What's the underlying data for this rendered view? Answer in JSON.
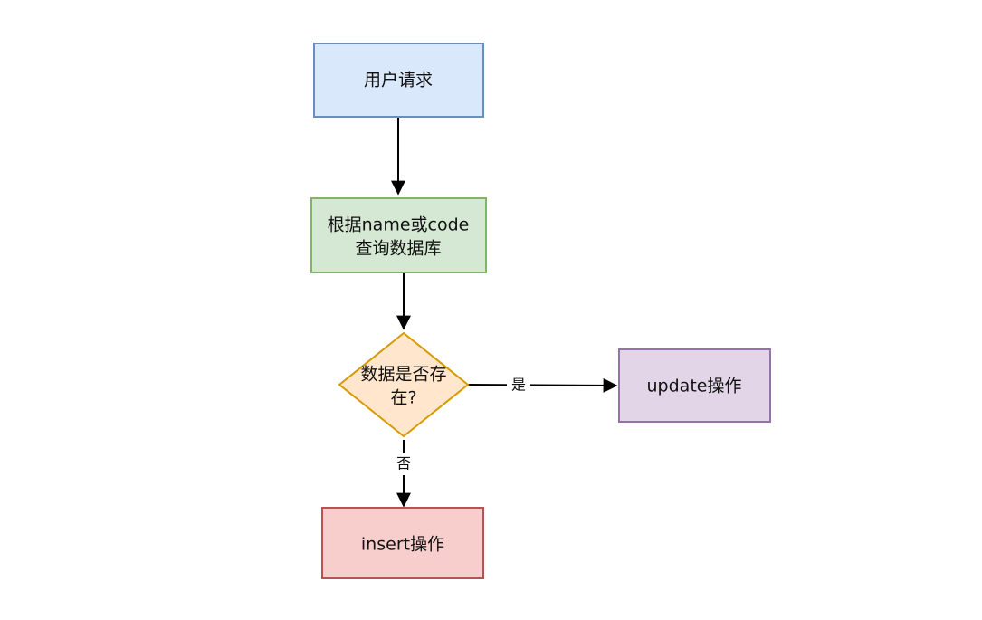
{
  "diagram": {
    "nodes": {
      "user_request": {
        "text": "用户请求",
        "fill": "#dae8fc",
        "stroke": "#6c8ebf"
      },
      "query_db": {
        "line1": "根据name或code",
        "line2": "查询数据库",
        "fill": "#d5e8d4",
        "stroke": "#82b366"
      },
      "exists_check": {
        "line1": "数据是否存",
        "line2": "在?",
        "fill": "#ffe6cc",
        "stroke": "#d79b00"
      },
      "update_op": {
        "text": "update操作",
        "fill": "#e1d5e7",
        "stroke": "#9673a6"
      },
      "insert_op": {
        "text": "insert操作",
        "fill": "#f8cecc",
        "stroke": "#b85450"
      }
    },
    "edges": {
      "yes_label": "是",
      "no_label": "否"
    },
    "edge_color": "#000000"
  }
}
